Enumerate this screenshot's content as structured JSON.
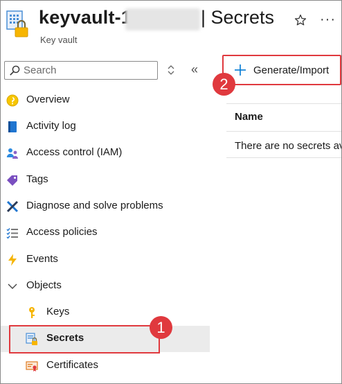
{
  "header": {
    "title_prefix": "keyvault-1",
    "title_suffix": "| Secrets",
    "subtitle": "Key vault",
    "more_label": "···"
  },
  "sidebar": {
    "search_placeholder": "Search",
    "collapse_label": "«",
    "items": [
      {
        "label": "Overview",
        "icon": "overview-icon"
      },
      {
        "label": "Activity log",
        "icon": "activity-log-icon"
      },
      {
        "label": "Access control (IAM)",
        "icon": "iam-icon"
      },
      {
        "label": "Tags",
        "icon": "tag-icon"
      },
      {
        "label": "Diagnose and solve problems",
        "icon": "wrench-icon"
      },
      {
        "label": "Access policies",
        "icon": "policy-list-icon"
      },
      {
        "label": "Events",
        "icon": "lightning-icon"
      },
      {
        "label": "Objects",
        "icon": "chevron-down-icon"
      },
      {
        "label": "Keys",
        "icon": "key-icon"
      },
      {
        "label": "Secrets",
        "icon": "secret-icon",
        "selected": true
      },
      {
        "label": "Certificates",
        "icon": "certificate-icon"
      }
    ]
  },
  "main": {
    "generate_label": "Generate/Import",
    "column_name": "Name",
    "empty_message": "There are no secrets av"
  },
  "callouts": {
    "one": "1",
    "two": "2"
  },
  "colors": {
    "accent_red": "#e0393e",
    "azure_blue": "#0078d4",
    "selected_bg": "#ebebeb"
  }
}
